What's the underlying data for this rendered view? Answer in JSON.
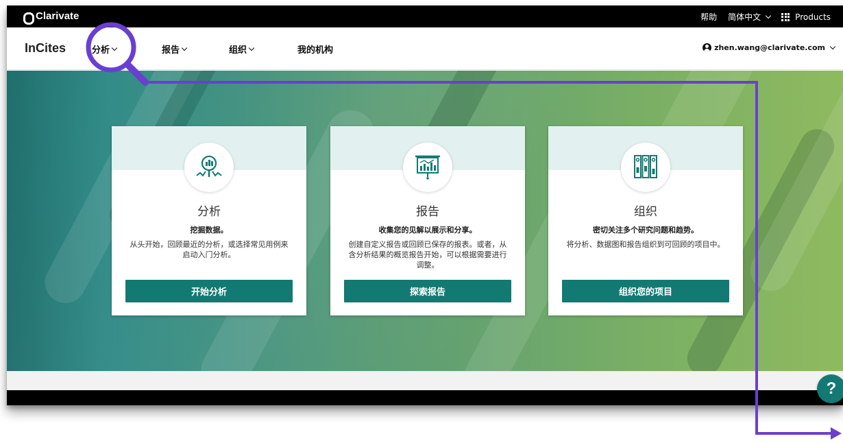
{
  "topbar": {
    "brand": "Clarivate",
    "help": "帮助",
    "language": "简体中文",
    "products": "Products"
  },
  "nav": {
    "logo": "InCites",
    "items": [
      {
        "label": "分析"
      },
      {
        "label": "报告"
      },
      {
        "label": "组织"
      },
      {
        "label": "我的机构"
      }
    ],
    "user": "zhen.wang@clarivate.com"
  },
  "cards": [
    {
      "icon": "analysis-magnifier-icon",
      "title": "分析",
      "subtitle": "挖掘数据。",
      "desc_line1": "从头开始，回顾最近的分析，或选择常见用例来",
      "desc_line2": "启动入门分析。",
      "desc_line3": "",
      "button": "开始分析"
    },
    {
      "icon": "presentation-board-icon",
      "title": "报告",
      "subtitle": "收集您的见解以展示和分享。",
      "desc_line1": "创建自定义报告或回顾已保存的报表。或者，从",
      "desc_line2": "含分析结果的概览报告开始，可以根据需要进行",
      "desc_line3": "调整。",
      "button": "探索报告"
    },
    {
      "icon": "binders-icon",
      "title": "组织",
      "subtitle": "密切关注多个研究问题和趋势。",
      "desc_line1": "将分析、数据图和报告组织到可回顾的项目中。",
      "desc_line2": "",
      "desc_line3": "",
      "button": "组织您的项目"
    }
  ],
  "help_button": "?",
  "colors": {
    "accent_teal": "#127a73",
    "annotation_purple": "#6a3fd0",
    "card_header_tint": "#e3f0f0"
  }
}
